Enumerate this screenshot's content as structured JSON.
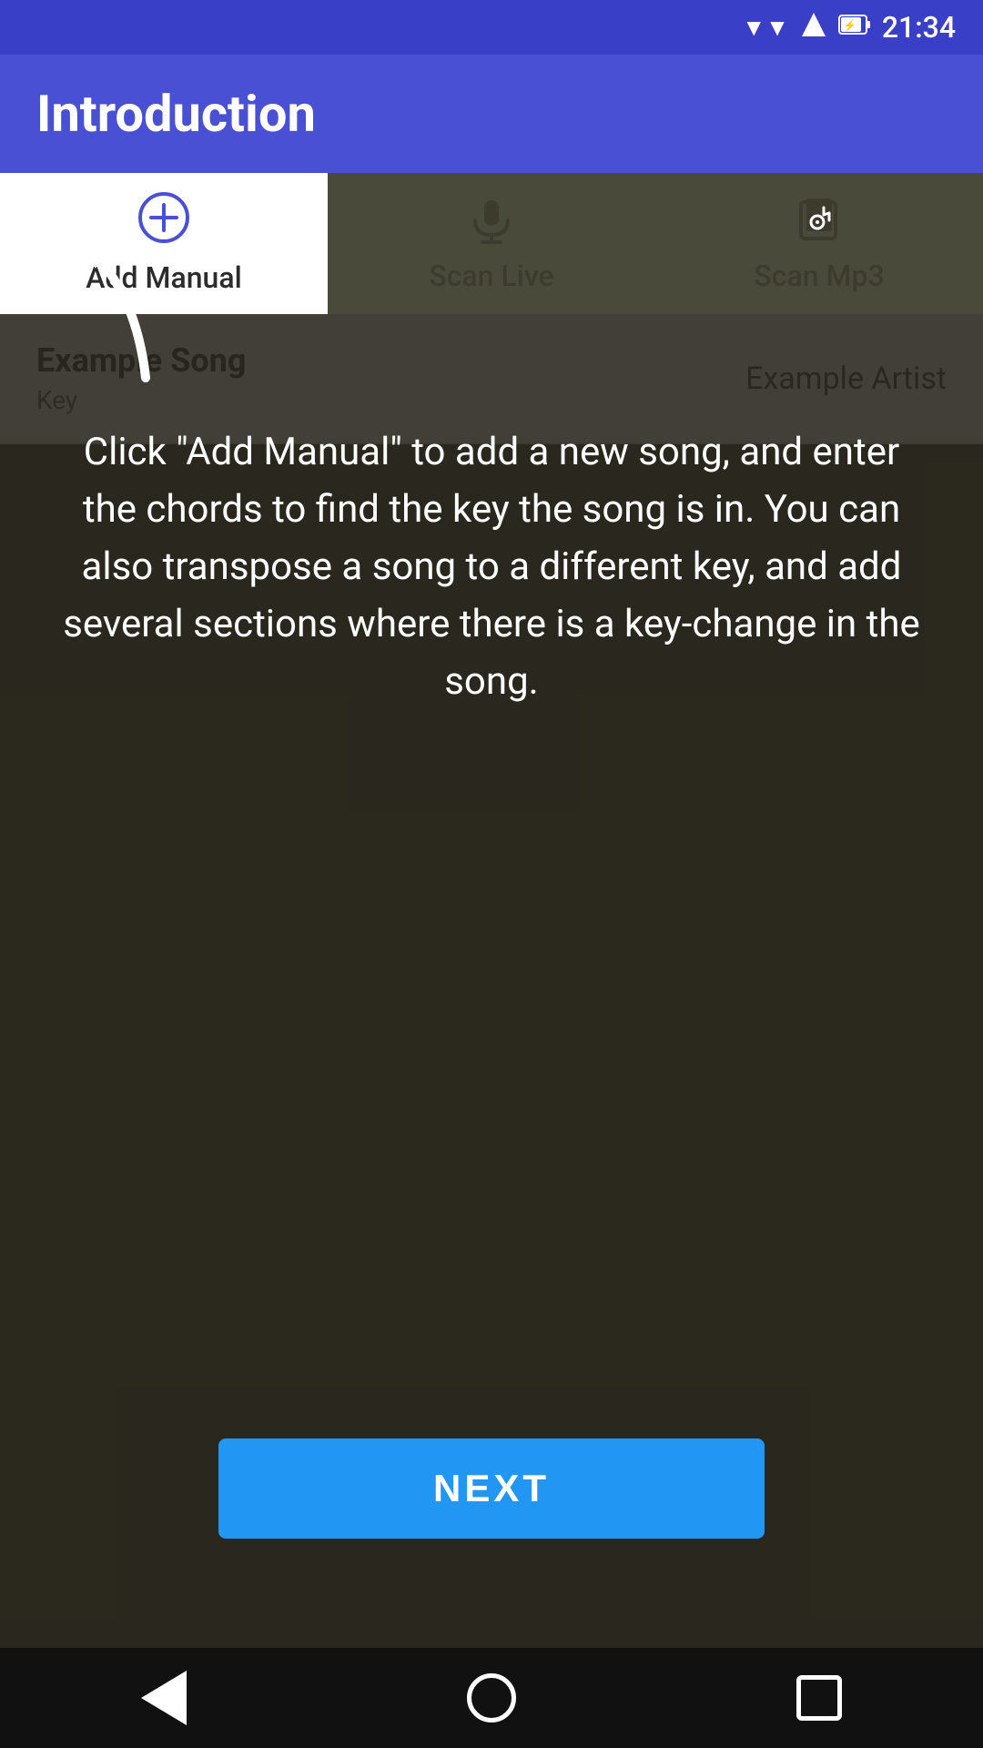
{
  "statusBar": {
    "time": "21:34",
    "wifiIcon": "▼",
    "signalIcon": "▲",
    "batteryIcon": "🔋"
  },
  "appBar": {
    "title": "Introduction"
  },
  "tabs": [
    {
      "id": "add-manual",
      "label": "Add Manual",
      "icon": "➕",
      "active": true
    },
    {
      "id": "scan-live",
      "label": "Scan Live",
      "icon": "🎙",
      "active": false
    },
    {
      "id": "scan-mp3",
      "label": "Scan Mp3",
      "icon": "🎵",
      "active": false
    }
  ],
  "songList": {
    "items": [
      {
        "title": "Example Song",
        "artist": "Example Artist",
        "key": "Key"
      }
    ]
  },
  "introText": "Click \"Add Manual\" to add a new song, and enter the chords to find the key the song is in.  You can also transpose a song to a different key, and add several sections where there is a key-change in the song.",
  "nextButton": {
    "label": "NEXT"
  },
  "navBar": {
    "backLabel": "back",
    "homeLabel": "home",
    "squareLabel": "recents"
  }
}
